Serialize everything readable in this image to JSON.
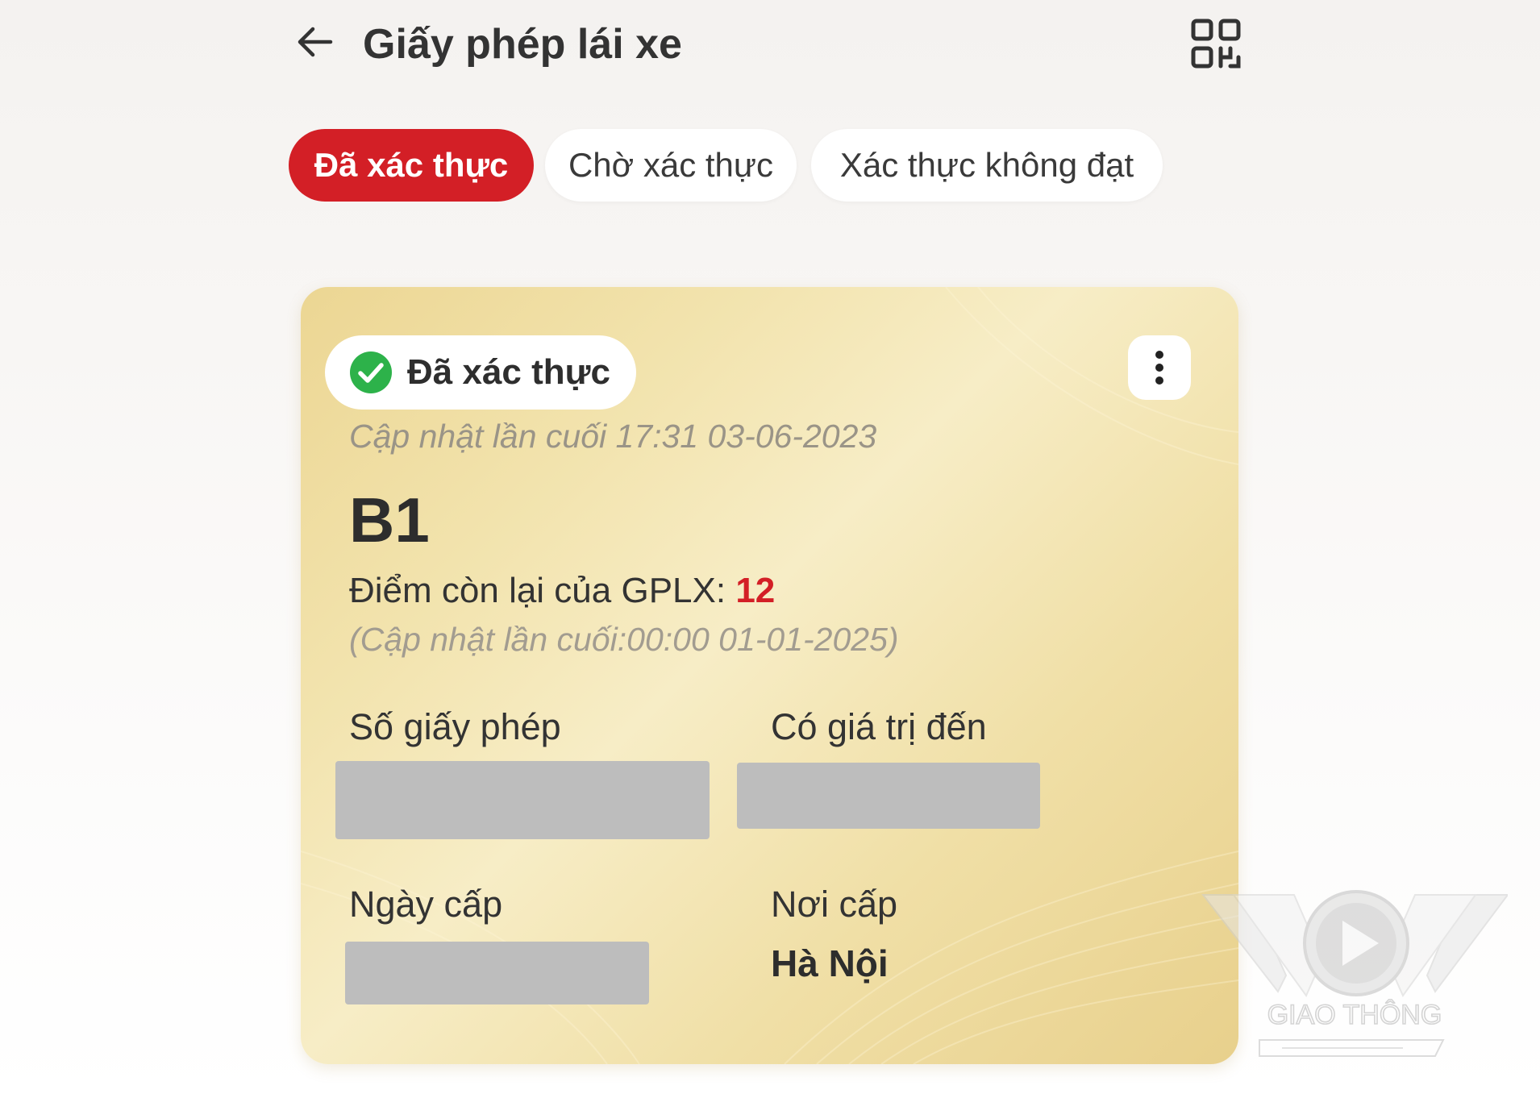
{
  "header": {
    "title": "Giấy phép lái xe",
    "back_icon": "arrow-left-icon",
    "qr_icon": "qr-code-icon"
  },
  "tabs": [
    {
      "label": "Đã xác thực",
      "active": true
    },
    {
      "label": "Chờ xác thực",
      "active": false
    },
    {
      "label": "Xác thực không đạt",
      "active": false
    }
  ],
  "card": {
    "status_label": "Đã xác thực",
    "status_icon": "check-circle-icon",
    "status_color": "#2db24a",
    "last_updated": "Cập nhật lần cuối 17:31 03-06-2023",
    "license_class": "B1",
    "points_label": "Điểm còn lại của GPLX: ",
    "points_value": "12",
    "points_updated": "(Cập nhật lần cuối:00:00 01-01-2025)",
    "license_number_label": "Số giấy phép",
    "valid_until_label": "Có giá trị đến",
    "issue_date_label": "Ngày cấp",
    "issue_place_label": "Nơi cấp",
    "issue_place_value": "Hà Nội"
  },
  "watermark": {
    "brand": "VOV",
    "caption": "GIAO THÔNG"
  },
  "colors": {
    "accent": "#d31f26",
    "card_gold": "#f0dfa6",
    "redaction": "#bdbdbd"
  }
}
